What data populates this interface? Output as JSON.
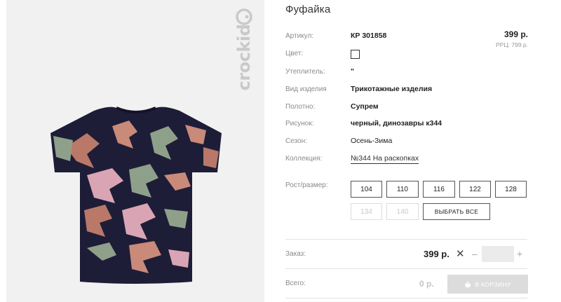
{
  "brand": {
    "logo_text": "crockid"
  },
  "product": {
    "title": "Фуфайка",
    "attributes": {
      "article": {
        "label": "Артикул:",
        "value": "КР 301858"
      },
      "color": {
        "label": "Цвет:"
      },
      "insulation": {
        "label": "Утеплитель:",
        "value": "\""
      },
      "kind": {
        "label": "Вид изделия",
        "value": "Трикотажные изделия"
      },
      "fabric": {
        "label": "Полотно:",
        "value": "Супрем"
      },
      "print": {
        "label": "Рисунок:",
        "value": "черный, динозавры к344"
      },
      "season": {
        "label": "Сезон:",
        "value": "Осень-Зима"
      },
      "collection": {
        "label": "Коллекция:",
        "value": "№344 На раскопках"
      }
    },
    "price": "399 р.",
    "rrc": "РРЦ: 799 р."
  },
  "sizes": {
    "label": "Рост/размер:",
    "available": [
      "104",
      "110",
      "116",
      "122",
      "128"
    ],
    "unavailable": [
      "134",
      "140"
    ],
    "select_all_label": "ВЫБРАТЬ ВСЕ"
  },
  "order": {
    "label": "Заказ:",
    "price": "399 р.",
    "multiply_symbol": "✕",
    "minus": "–",
    "plus": "+",
    "quantity": ""
  },
  "total": {
    "label": "Всего:",
    "value": "0 р.",
    "cart_button_label": "В КОРЗИНУ",
    "cart_icon": "basket-icon"
  },
  "colors": {
    "shirt": "#1e1d38",
    "accent_salmon": "#c98a7a",
    "accent_green": "#8fa08a",
    "accent_pink": "#d9a5b5",
    "panel_bg": "#f1f1f1",
    "cart_button": "#dcdcdc"
  }
}
